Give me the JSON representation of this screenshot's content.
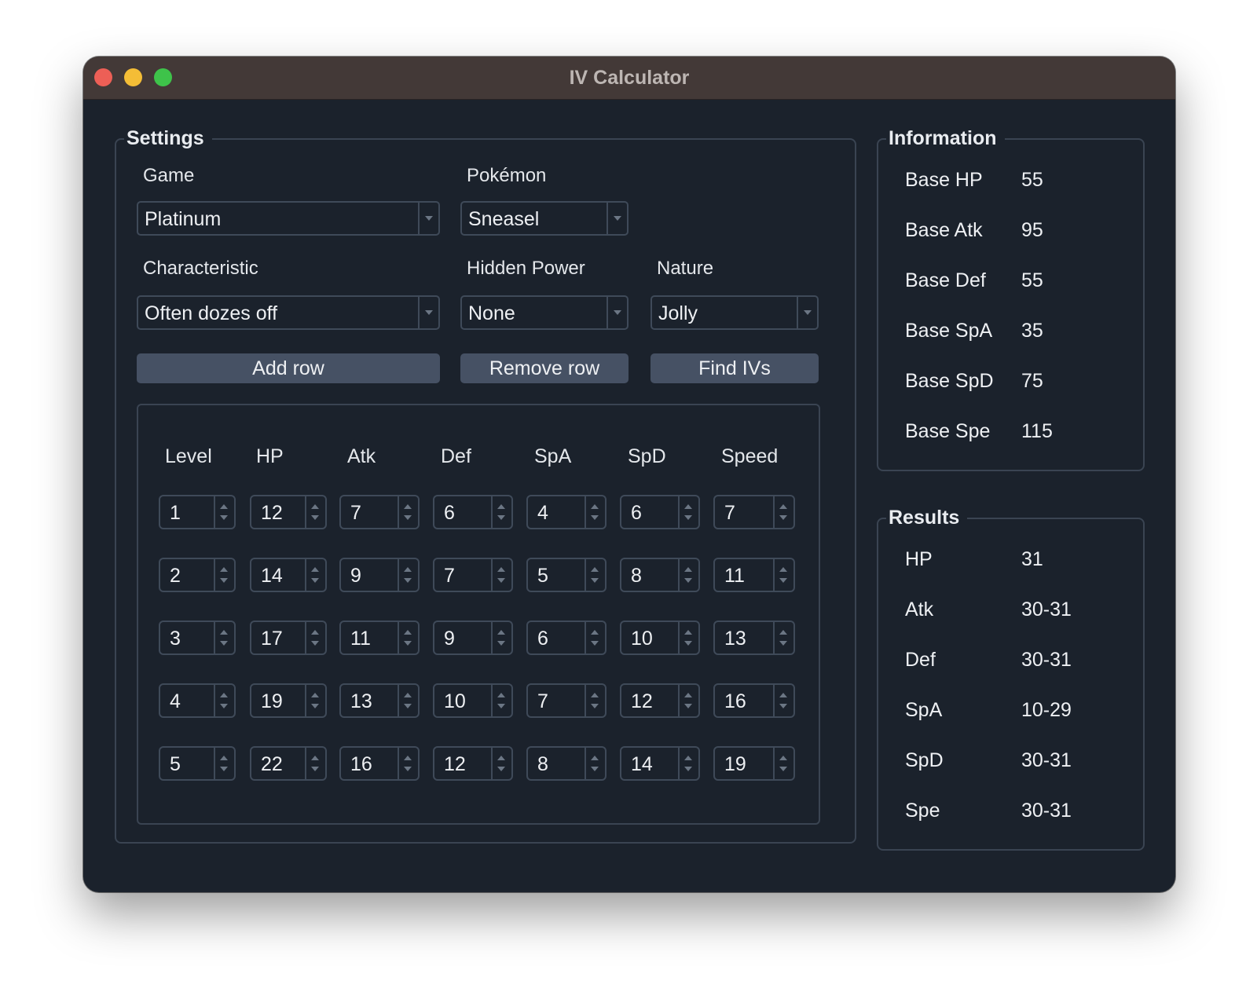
{
  "window": {
    "title": "IV Calculator"
  },
  "settings": {
    "title": "Settings",
    "game": {
      "label": "Game",
      "value": "Platinum"
    },
    "pokemon": {
      "label": "Pokémon",
      "value": "Sneasel"
    },
    "characteristic": {
      "label": "Characteristic",
      "value": "Often dozes off"
    },
    "hidden_power": {
      "label": "Hidden Power",
      "value": "None"
    },
    "nature": {
      "label": "Nature",
      "value": "Jolly"
    },
    "buttons": {
      "add_row": "Add row",
      "remove_row": "Remove row",
      "find_ivs": "Find IVs"
    },
    "table": {
      "columns": [
        "Level",
        "HP",
        "Atk",
        "Def",
        "SpA",
        "SpD",
        "Speed"
      ],
      "rows": [
        [
          "1",
          "12",
          "7",
          "6",
          "4",
          "6",
          "7"
        ],
        [
          "2",
          "14",
          "9",
          "7",
          "5",
          "8",
          "11"
        ],
        [
          "3",
          "17",
          "11",
          "9",
          "6",
          "10",
          "13"
        ],
        [
          "4",
          "19",
          "13",
          "10",
          "7",
          "12",
          "16"
        ],
        [
          "5",
          "22",
          "16",
          "12",
          "8",
          "14",
          "19"
        ]
      ]
    }
  },
  "information": {
    "title": "Information",
    "items": [
      {
        "label": "Base HP",
        "value": "55"
      },
      {
        "label": "Base Atk",
        "value": "95"
      },
      {
        "label": "Base Def",
        "value": "55"
      },
      {
        "label": "Base SpA",
        "value": "35"
      },
      {
        "label": "Base SpD",
        "value": "75"
      },
      {
        "label": "Base Spe",
        "value": "115"
      }
    ]
  },
  "results": {
    "title": "Results",
    "items": [
      {
        "label": "HP",
        "value": "31"
      },
      {
        "label": "Atk",
        "value": "30-31"
      },
      {
        "label": "Def",
        "value": "30-31"
      },
      {
        "label": "SpA",
        "value": "10-29"
      },
      {
        "label": "SpD",
        "value": "30-31"
      },
      {
        "label": "Spe",
        "value": "30-31"
      }
    ]
  }
}
